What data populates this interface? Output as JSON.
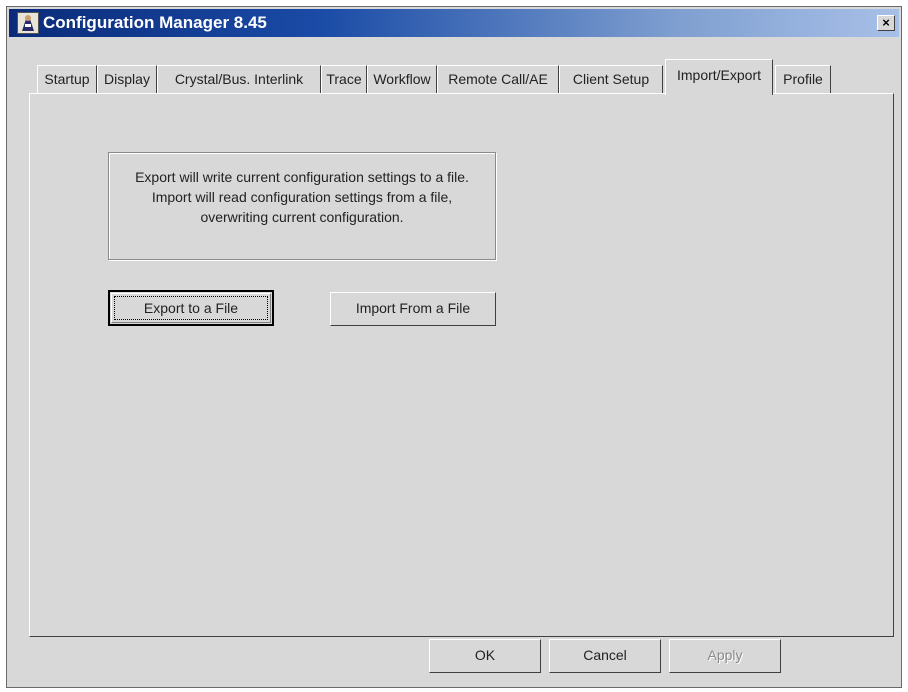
{
  "window": {
    "title": "Configuration Manager 8.45",
    "close_glyph": "×"
  },
  "tabs": [
    {
      "label": "Startup"
    },
    {
      "label": "Display"
    },
    {
      "label": "Crystal/Bus. Interlink"
    },
    {
      "label": "Trace"
    },
    {
      "label": "Workflow"
    },
    {
      "label": "Remote Call/AE"
    },
    {
      "label": "Client Setup"
    },
    {
      "label": "Import/Export",
      "active": true
    },
    {
      "label": "Profile"
    }
  ],
  "panel": {
    "info_text": "Export will write current configuration settings to a file. Import will read configuration settings from a file, overwriting current configuration.",
    "export_label": "Export to a File",
    "import_label": "Import From a File"
  },
  "footer": {
    "ok_label": "OK",
    "cancel_label": "Cancel",
    "apply_label": "Apply"
  }
}
